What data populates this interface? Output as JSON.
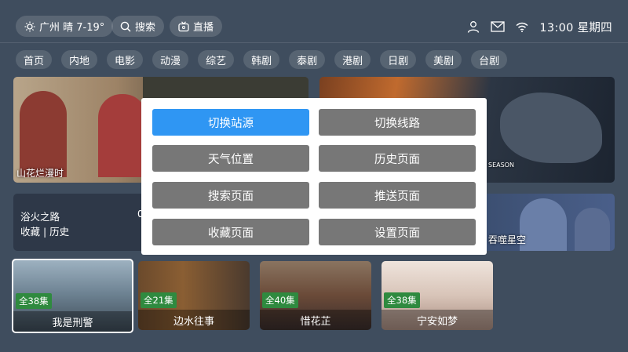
{
  "topbar": {
    "weather": "广州 晴 7-19°",
    "search": "搜索",
    "live": "直播",
    "time": "13:00 星期四"
  },
  "tabs": [
    "首页",
    "内地",
    "电影",
    "动漫",
    "综艺",
    "韩剧",
    "泰剧",
    "港剧",
    "日剧",
    "美剧",
    "台剧"
  ],
  "featured": [
    {
      "title": "山花烂漫时"
    },
    {
      "title": "SEASON"
    },
    {
      "title": "吞噬星空"
    }
  ],
  "history": {
    "title": "浴火之路",
    "links": "收藏 | 历史",
    "extra": "0"
  },
  "menu": {
    "items": [
      "切换站源",
      "切换线路",
      "天气位置",
      "历史页面",
      "搜索页面",
      "推送页面",
      "收藏页面",
      "设置页面"
    ]
  },
  "posters": [
    {
      "title": "我是刑警",
      "badge": "全38集"
    },
    {
      "title": "边水往事",
      "badge": "全21集"
    },
    {
      "title": "惜花芷",
      "badge": "全40集"
    },
    {
      "title": "宁安如梦",
      "badge": "全38集"
    }
  ]
}
